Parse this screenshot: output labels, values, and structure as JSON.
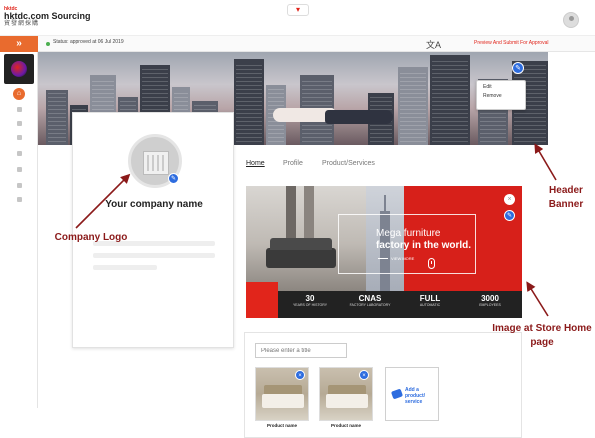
{
  "topbar": {
    "brand_logo_text": "hktdc",
    "brand_name": "hktdc.com Sourcing",
    "brand_cn": "貿發網採購",
    "collapse_icon": "chevron-down-icon",
    "user_icon": "user-icon"
  },
  "rail": {
    "expand_icon": "double-chevron-right-icon",
    "expand_glyph": "»",
    "home_icon": "home-icon",
    "items": [
      "user-icon",
      "chat-icon",
      "settings-icon",
      "list-icon",
      "box-icon",
      "link-icon",
      "document-icon"
    ]
  },
  "status": {
    "text": "Status: approved at 06 Jul 2019",
    "translate_icon": "translate-icon",
    "approval_link": "Preview And Submit For Approval"
  },
  "banner": {
    "edit_icon": "pencil-icon",
    "menu": [
      "Edit",
      "Remove"
    ]
  },
  "company": {
    "name": "Your company name",
    "logo_icon": "building-icon",
    "edit_icon": "pencil-icon"
  },
  "tabs": [
    "Home",
    "Profile",
    "Product/Services"
  ],
  "store": {
    "promo_line1": "Mega furniture",
    "promo_line2": "factory in the world.",
    "cta": "VIEW MORE",
    "stats": [
      {
        "value": "30",
        "label": "YEARS OF HISTORY"
      },
      {
        "value": "CNAS",
        "label": "FACTORY LABORATORY"
      },
      {
        "value": "FULL",
        "label": "AUTOMATIC"
      },
      {
        "value": "3000",
        "label": "EMPLOYEES"
      }
    ]
  },
  "products": {
    "title_placeholder": "Please enter a title",
    "items": [
      {
        "name": "Product name"
      },
      {
        "name": "Product name"
      }
    ],
    "add_label": "Add a product/ service"
  },
  "annotations": {
    "company_logo": "Company Logo",
    "header_banner": "Header Banner",
    "store_image": "Image at Store Home page"
  },
  "colors": {
    "brand_red": "#e1251b",
    "rail_orange": "#e96b2e",
    "edit_blue": "#2d6cdf",
    "annotation": "#8b1a1a"
  }
}
